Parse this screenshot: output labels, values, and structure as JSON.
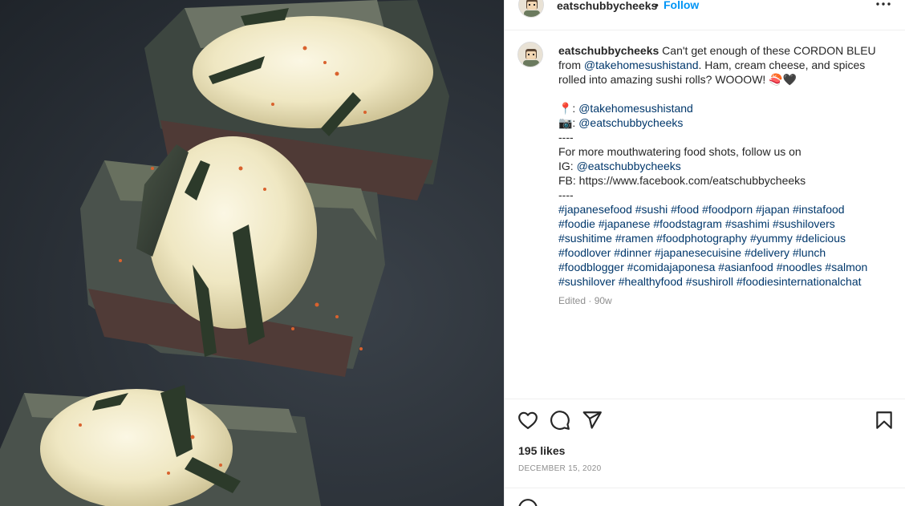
{
  "post": {
    "username": "eatschubbycheeks",
    "separator": "•",
    "follow_label": "Follow",
    "more_icon": "more-options-icon"
  },
  "caption": {
    "username": "eatschubbycheeks",
    "line1_text": " Can't get enough of these CORDON BLEU",
    "line2_prefix": "from ",
    "line2_mention": "@takehomesushistand",
    "line2_suffix": ". Ham, cream cheese, and spices",
    "line3_text": "rolled into amazing sushi rolls? WOOOW! 🍣🖤",
    "location_prefix": "📍: ",
    "location_mention": "@takehomesushistand",
    "camera_prefix": "📷: ",
    "camera_mention": "@eatschubbycheeks",
    "divider1": "----",
    "follow_line": "For more mouthwatering food shots, follow us on",
    "ig_prefix": "IG: ",
    "ig_mention": "@eatschubbycheeks",
    "fb_line": "FB: https://www.facebook.com/eatschubbycheeks",
    "divider2": "----",
    "hashtag_lines": [
      [
        "#japanesefood",
        "#sushi",
        "#food",
        "#foodporn",
        "#japan",
        "#instafood"
      ],
      [
        "#foodie",
        "#japanese",
        "#foodstagram",
        "#sashimi",
        "#sushilovers"
      ],
      [
        "#sushitime",
        "#ramen",
        "#foodphotography",
        "#yummy",
        "#delicious"
      ],
      [
        "#foodlover",
        "#dinner",
        "#japanesecuisine",
        "#delivery",
        "#lunch"
      ],
      [
        "#foodblogger",
        "#comidajaponesa",
        "#asianfood",
        "#noodles",
        "#salmon"
      ],
      [
        "#sushilover",
        "#healthyfood",
        "#sushiroll",
        "#foodiesinternationalchat"
      ]
    ],
    "edited": "Edited · 90w"
  },
  "actions": {
    "likes": "195 likes",
    "date": "DECEMBER 15, 2020"
  },
  "colors": {
    "link": "#00376b",
    "follow": "#0095f6",
    "muted": "#8e8e8e",
    "border": "#efefef"
  }
}
